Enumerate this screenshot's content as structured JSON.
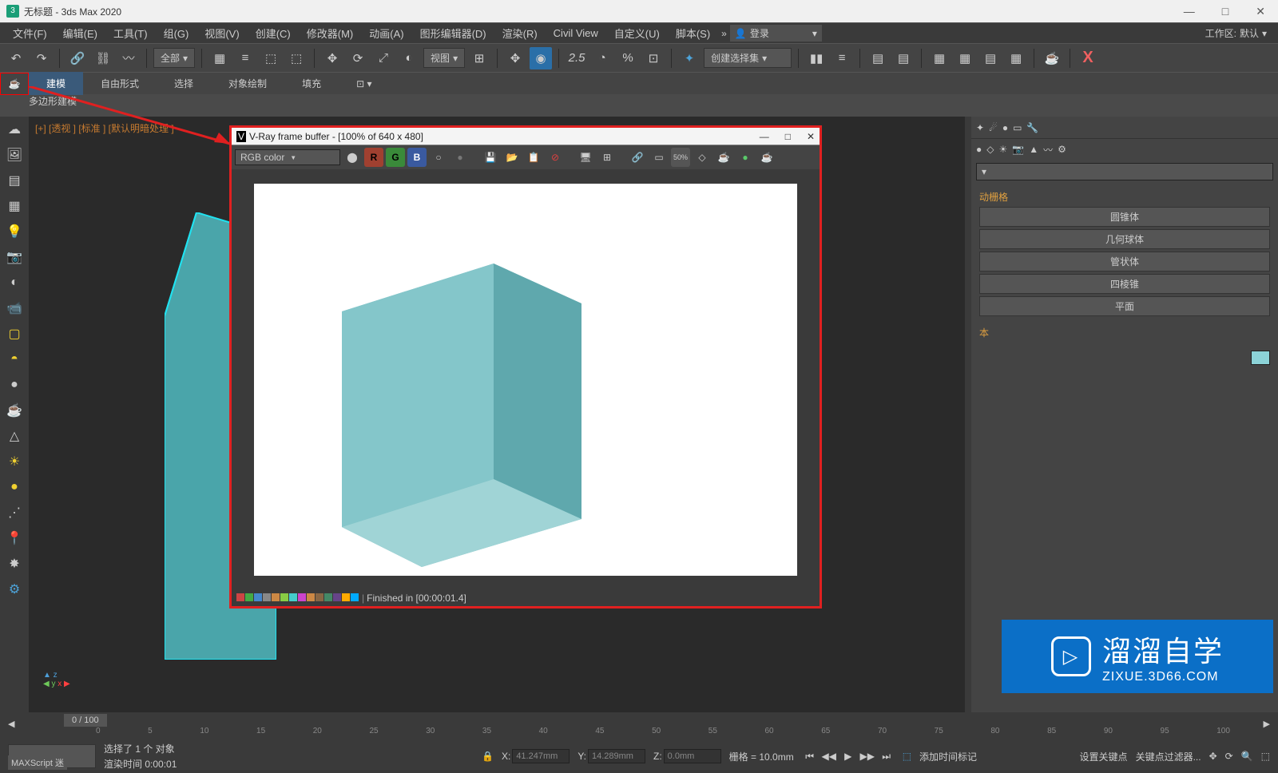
{
  "title": "无标题 - 3ds Max 2020",
  "window_controls": {
    "min": "—",
    "max": "□",
    "close": "✕"
  },
  "menu": [
    "文件(F)",
    "编辑(E)",
    "工具(T)",
    "组(G)",
    "视图(V)",
    "创建(C)",
    "修改器(M)",
    "动画(A)",
    "图形编辑器(D)",
    "渲染(R)",
    "Civil View",
    "自定义(U)",
    "脚本(S)"
  ],
  "login": {
    "label": "登录"
  },
  "workspace": {
    "label": "工作区:",
    "value": "默认"
  },
  "toolbar": {
    "filter_all": "全部",
    "view_drop": "视图",
    "selset": "创建选择集"
  },
  "ribbon": {
    "tabs": [
      "建模",
      "自由形式",
      "选择",
      "对象绘制",
      "填充"
    ],
    "poly": "多边形建模"
  },
  "viewport": {
    "label": "[+] [透视 ] [标准 ] [默认明暗处理 ]"
  },
  "vfb": {
    "title": "V-Ray frame buffer - [100% of 640 x 480]",
    "controls": {
      "min": "—",
      "max": "□",
      "close": "✕"
    },
    "channel_drop": "RGB color",
    "ch_r": "R",
    "ch_g": "G",
    "ch_b": "B",
    "pct": "50%",
    "status": "Finished in [00:00:01.4]"
  },
  "rightpanel": {
    "section1": "动栅格",
    "primitives": [
      "圆锥体",
      "几何球体",
      "管状体",
      "四棱锥",
      "平面"
    ],
    "section2": "本"
  },
  "timeline": {
    "frame": "0 / 100",
    "ticks": [
      "0",
      "5",
      "10",
      "15",
      "20",
      "25",
      "30",
      "35",
      "40",
      "45",
      "50",
      "55",
      "60",
      "65",
      "70",
      "75",
      "80",
      "85",
      "90",
      "95",
      "100"
    ]
  },
  "status": {
    "sel": "选择了 1 个 对象",
    "render": "渲染时间  0:00:01",
    "x_label": "X:",
    "x_val": "41.247mm",
    "y_label": "Y:",
    "y_val": "14.289mm",
    "z_label": "Z:",
    "z_val": "0.0mm",
    "grid_label": "栅格 = 10.0mm",
    "addtime": "添加时间标记",
    "maxscript": "MAXScript 迷",
    "setkey": "设置关键点",
    "keyfilter": "关键点过滤器..."
  },
  "watermark": {
    "main": "溜溜自学",
    "url": "ZIXUE.3D66.COM"
  }
}
